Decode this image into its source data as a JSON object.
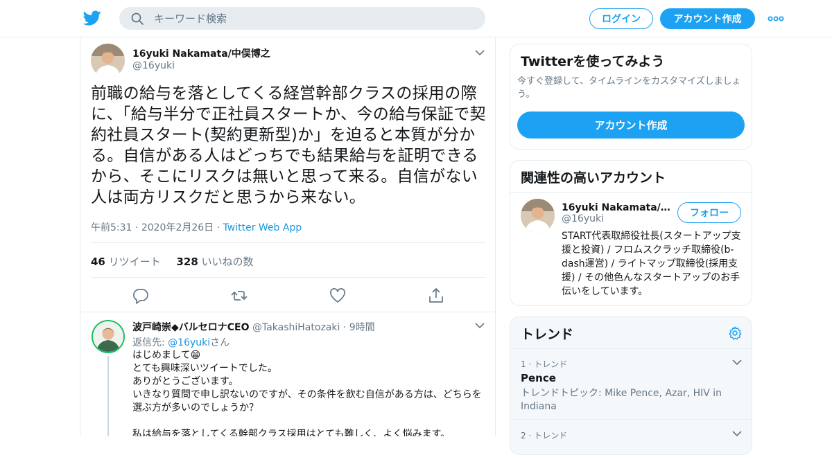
{
  "header": {
    "search_placeholder": "キーワード検索",
    "login_label": "ログイン",
    "signup_label": "アカウント作成",
    "more_icon": "more-icon",
    "brand_color": "#1da1f2"
  },
  "tweet": {
    "author_name": "16yuki Nakamata/中俣博之",
    "author_handle": "@16yuki",
    "text": "前職の給与を落としてくる経営幹部クラスの採用の際に、「給与半分で正社員スタートか、今の給与保証で契約社員スタート(契約更新型)か」を迫ると本質が分かる。自信がある人はどっちでも結果給与を証明できるから、そこにリスクは無いと思って来る。自信がない人は両方リスクだと思うから来ない。",
    "time": "午前5:31",
    "sep": "·",
    "date": "2020年2月26日",
    "source": "Twitter Web App",
    "retweet_count": "46",
    "retweet_label": "リツイート",
    "like_count": "328",
    "like_label": "いいねの数"
  },
  "reply": {
    "author_name": "波戸崎崇◆バルセロナCEO",
    "author_handle": "@TakashiHatozaki",
    "dot": "·",
    "age": "9時間",
    "reply_to_prefix": "返信先: ",
    "reply_to_handle": "@16yuki",
    "reply_to_suffix": "さん",
    "text_line1": "はじめまして",
    "emoji": "😁",
    "text_rest": "\nとても興味深いツイートでした。\nありがとうございます。\nいきなり質問で申し訳ないのですが、その条件を飲む自信がある方は、どちらを選ぶ方が多いのでしょうか？\n\n私は給与を落としてくる幹部クラス採用はとても難しく、よく悩みます。"
  },
  "sidebar": {
    "signup_card": {
      "title": "Twitterを使ってみよう",
      "subtitle": "今すぐ登録して、タイムラインをカスタマイズしましょう。",
      "button": "アカウント作成"
    },
    "related": {
      "title": "関連性の高いアカウント",
      "name": "16yuki Nakamata/中俣博之",
      "handle": "@16yuki",
      "follow_label": "フォロー",
      "bio": "START代表取締役社長(スタートアップ支援と投資) / フロムスクラッチ取締役(b-dash運営) / ライトマップ取締役(採用支援) / その他色んなスタートアップのお手伝いをしています。"
    },
    "trends": {
      "title": "トレンド",
      "items": [
        {
          "rank": "1 · トレンド",
          "name": "Pence",
          "topic": "トレンドトピック: Mike Pence, Azar, HIV in Indiana"
        },
        {
          "rank": "2 · トレンド",
          "name": "",
          "topic": ""
        }
      ]
    }
  }
}
